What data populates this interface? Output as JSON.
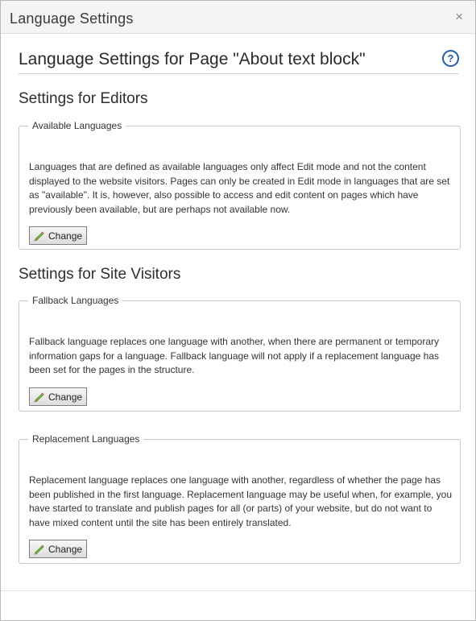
{
  "dialog": {
    "title": "Language Settings",
    "close_glyph": "×",
    "close_icon": "close-icon"
  },
  "page_heading": "Language Settings for Page \"About text block\"",
  "help_icon": {
    "glyph": "?",
    "icon": "help-icon",
    "color": "#1e5ea8"
  },
  "editors": {
    "heading": "Settings for Editors",
    "available": {
      "legend": "Available Languages",
      "description": "Languages that are defined as available languages only affect Edit mode and not the content displayed to the website visitors. Pages can only be created in Edit mode in languages that are set as \"available\". It is, however, also possible to access and edit content on pages which have previously been available, but are perhaps not available now.",
      "button_label": "Change",
      "button_icon": "pencil-icon"
    }
  },
  "visitors": {
    "heading": "Settings for Site Visitors",
    "fallback": {
      "legend": "Fallback Languages",
      "description": "Fallback language replaces one language with another, when there are permanent or temporary information gaps for a language. Fallback language will not apply if a replacement language has been set for the pages in the structure.",
      "button_label": "Change",
      "button_icon": "pencil-icon"
    },
    "replacement": {
      "legend": "Replacement Languages",
      "description": "Replacement language replaces one language with another, regardless of whether the page has been published in the first language. Replacement language may be useful when, for example, you have started to translate and publish pages for all (or parts) of your website, but do not want to have mixed content until the site has been entirely translated.",
      "button_label": "Change",
      "button_icon": "pencil-icon"
    }
  }
}
